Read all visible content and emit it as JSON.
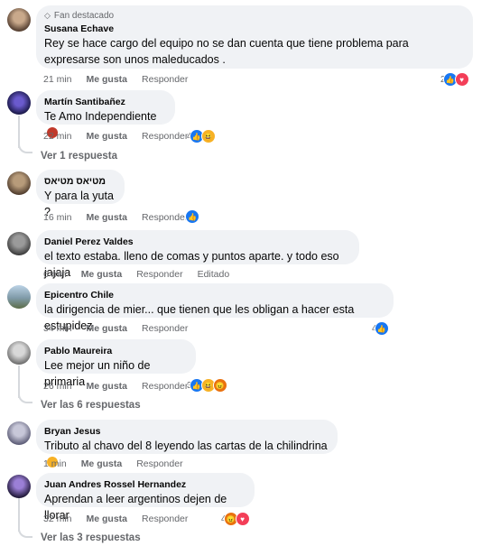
{
  "comments": [
    {
      "badge": "Fan destacado",
      "author": "Susana Echave",
      "text": "Rey se hace cargo del equipo no se dan cuenta que tiene problema para expresarse son unos maleducados .",
      "time": "21 min",
      "like": "Me gusta",
      "reply": "Responder",
      "reaction_count": "2",
      "reactions": [
        "like-icon",
        "love-icon"
      ]
    },
    {
      "author": "Martín Santibañez",
      "text": "Te Amo Independiente",
      "time": "22 min",
      "like": "Me gusta",
      "reply": "Responder",
      "reaction_count": "4",
      "reactions": [
        "like-icon",
        "haha-icon"
      ],
      "replies": "Ver 1 respuesta"
    },
    {
      "author": "מטיאס מטיאס",
      "text": "Y para la yuta ?",
      "time": "16 min",
      "like": "Me gusta",
      "reply": "Responder",
      "reaction_count": "",
      "reactions": [
        "like-icon"
      ]
    },
    {
      "author": "Daniel Perez Valdes",
      "text": "el texto estaba. lleno de comas y puntos aparte. y todo eso jajaja",
      "time": "6 min",
      "like": "Me gusta",
      "reply": "Responder",
      "edited": "Editado"
    },
    {
      "author": "Epicentro Chile",
      "text": "la dirigencia de mier... que tienen que les obligan a hacer esta estupidez",
      "time": "34 min",
      "like": "Me gusta",
      "reply": "Responder",
      "reaction_count": "4",
      "reactions": [
        "like-icon"
      ]
    },
    {
      "author": "Pablo Maureira",
      "text": "Lee mejor un niño de primaria",
      "time": "26 min",
      "like": "Me gusta",
      "reply": "Responder",
      "reaction_count": "3",
      "reactions": [
        "like-icon",
        "haha-icon",
        "angry-icon"
      ],
      "replies": "Ver las 6 respuestas"
    },
    {
      "author": "Bryan Jesus",
      "text": "Tributo al chavo del 8 leyendo las cartas de la chilindrina",
      "time": "1 min",
      "like": "Me gusta",
      "reply": "Responder"
    },
    {
      "author": "Juan Andres Rossel Hernandez",
      "text": "Aprendan a leer argentinos dejen de llorar",
      "time": "32 min",
      "like": "Me gusta",
      "reply": "Responder",
      "reaction_count": "4",
      "reactions": [
        "angry-icon",
        "love-icon"
      ],
      "replies": "Ver las 3 respuestas"
    }
  ]
}
